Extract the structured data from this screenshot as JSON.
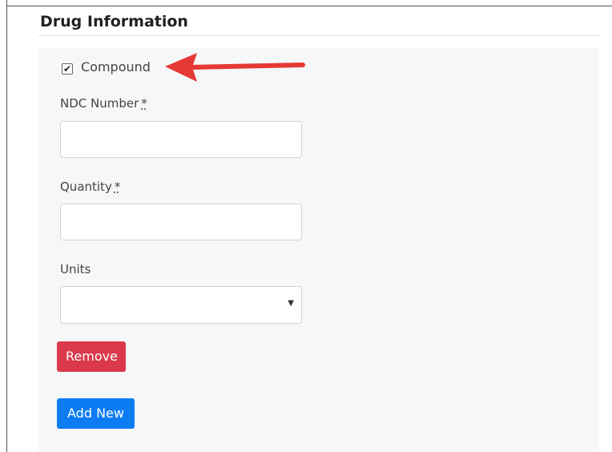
{
  "section": {
    "title": "Drug Information"
  },
  "form": {
    "compound": {
      "label": "Compound",
      "checked": true
    },
    "ndc": {
      "label": "NDC Number",
      "required_marker": "*",
      "value": ""
    },
    "quantity": {
      "label": "Quantity",
      "required_marker": "*",
      "value": ""
    },
    "units": {
      "label": "Units",
      "selected": ""
    }
  },
  "buttons": {
    "remove_label": "Remove",
    "add_new_label": "Add New"
  },
  "annotation": {
    "arrow_color": "#e53935"
  },
  "colors": {
    "remove": "#d9394b",
    "add_new": "#0d7cf2",
    "panel_bg": "#f6f7f8"
  },
  "icons": {
    "checkbox": "check-icon",
    "select": "caret-down-icon",
    "annotation": "arrow-left-icon"
  }
}
